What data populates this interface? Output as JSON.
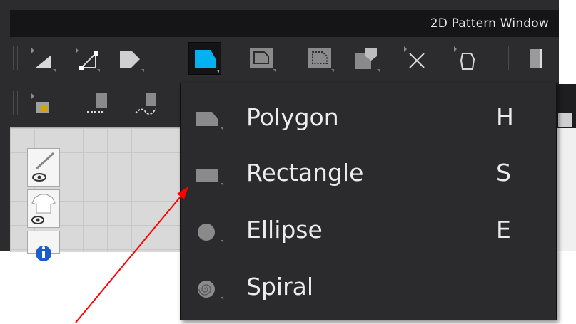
{
  "window": {
    "title": "2D Pattern Window"
  },
  "toolbar_row1": [
    {
      "name": "transform-pattern-tool-icon",
      "active": false
    },
    {
      "name": "edit-point-tool-icon",
      "active": false
    },
    {
      "name": "edit-curvature-tool-icon",
      "active": false
    },
    {
      "name": "polygon-tool-icon",
      "active": true
    },
    {
      "name": "internal-rectangle-tool-icon",
      "active": false
    },
    {
      "name": "internal-polygon-tool-icon",
      "active": false
    },
    {
      "name": "fold-tool-icon",
      "active": false
    },
    {
      "name": "trace-tool-icon",
      "active": false
    },
    {
      "name": "create-pattern-tool-icon",
      "active": false
    }
  ],
  "toolbar_row2": [
    {
      "name": "add-point-tool-icon"
    },
    {
      "name": "segment-sewing-tool-icon"
    },
    {
      "name": "free-sewing-tool-icon"
    }
  ],
  "menu": {
    "items": [
      {
        "label": "Polygon",
        "shortcut": "H",
        "icon": "polygon-icon"
      },
      {
        "label": "Rectangle",
        "shortcut": "S",
        "icon": "rectangle-icon"
      },
      {
        "label": "Ellipse",
        "shortcut": "E",
        "icon": "ellipse-icon"
      },
      {
        "label": "Spiral",
        "shortcut": "",
        "icon": "spiral-icon"
      }
    ]
  },
  "colors": {
    "active_tool": "#00a8e8",
    "annotation_arrow": "#ff0000"
  }
}
